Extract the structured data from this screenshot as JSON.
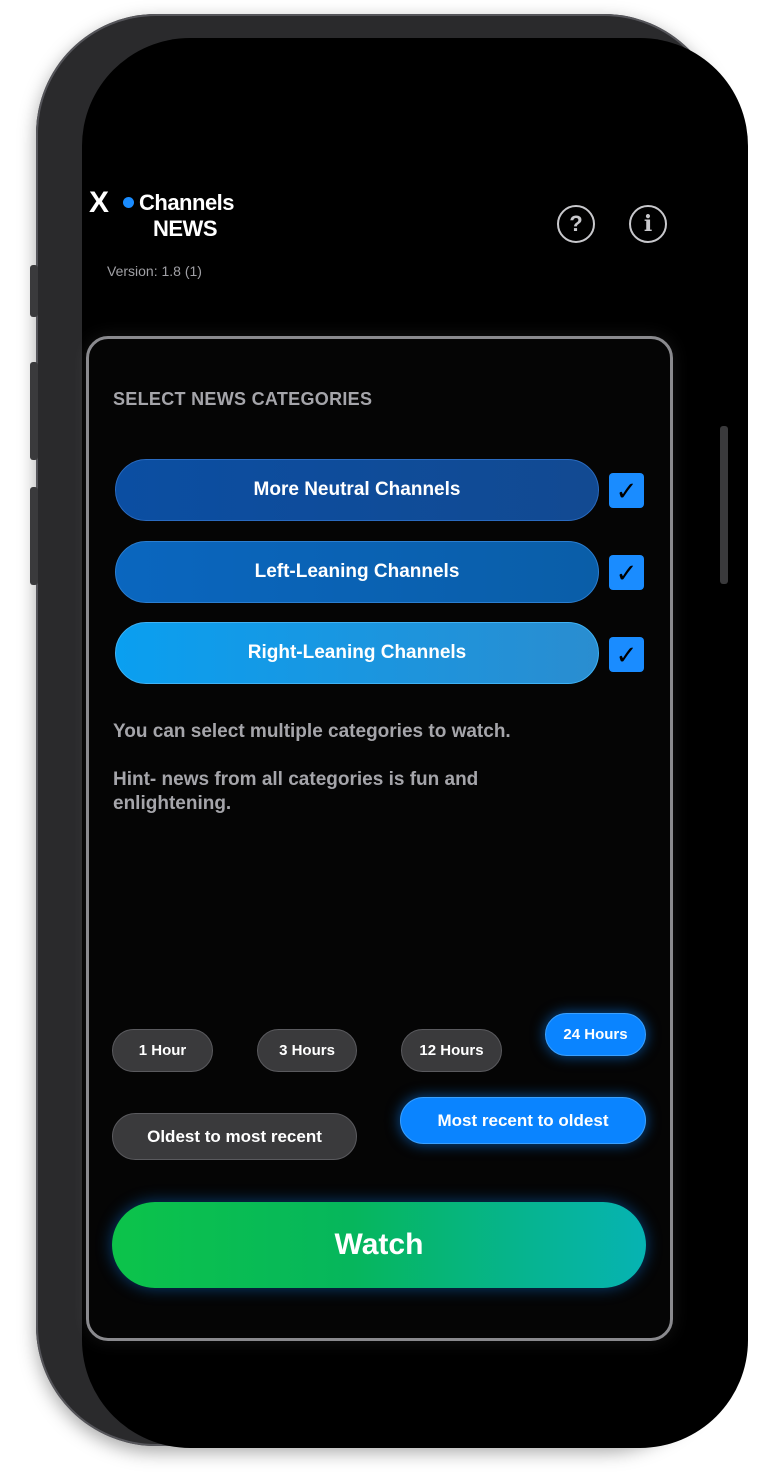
{
  "app": {
    "logo_x": "X",
    "logo_channels": "Channels",
    "logo_news": "NEWS",
    "version": "Version: 1.8 (1)"
  },
  "header": {
    "help_icon": "question-circle-icon",
    "help_glyph": "?",
    "info_icon": "info-circle-icon",
    "info_glyph": "i"
  },
  "categories": {
    "title": "SELECT NEWS CATEGORIES",
    "items": [
      {
        "label": "More Neutral Channels",
        "checked": true
      },
      {
        "label": "Left-Leaning Channels",
        "checked": true
      },
      {
        "label": "Right-Leaning Channels",
        "checked": true
      }
    ],
    "check_glyph": "✓",
    "hint_multi": "You can select multiple categories to watch.",
    "hint_fun": "Hint- news from all categories is fun and enlightening."
  },
  "time_range": {
    "options": [
      "1 Hour",
      "3 Hours",
      "12 Hours",
      "24 Hours"
    ],
    "selected": "24 Hours"
  },
  "sort_order": {
    "options": [
      "Oldest to most recent",
      "Most recent to oldest"
    ],
    "selected": "Most recent to oldest"
  },
  "watch_button": {
    "label": "Watch"
  },
  "colors": {
    "accent": "#0a84ff",
    "watch_start": "#0cc34a",
    "watch_end": "#06b3b3",
    "background": "#000000"
  }
}
